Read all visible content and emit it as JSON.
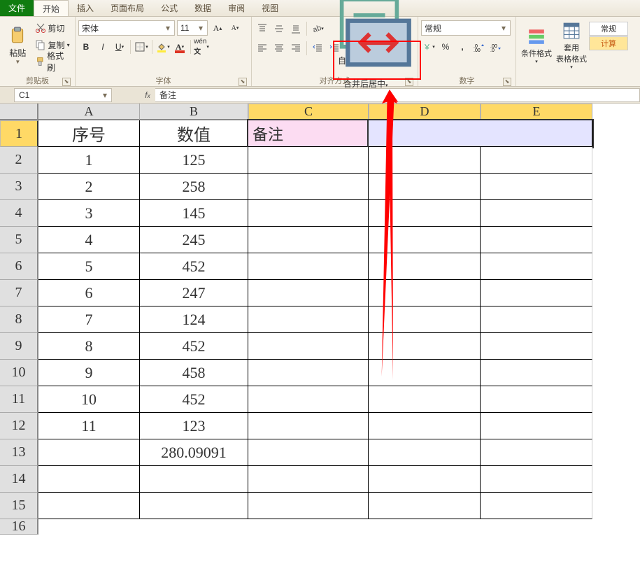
{
  "menu": {
    "file": "文件",
    "home": "开始",
    "insert": "插入",
    "pagelayout": "页面布局",
    "formulas": "公式",
    "data": "数据",
    "review": "审阅",
    "view": "视图"
  },
  "clipboard": {
    "paste": "粘贴",
    "cut": "剪切",
    "copy": "复制",
    "fmtpainter": "格式刷",
    "group": "剪贴板"
  },
  "font": {
    "name": "宋体",
    "size": "11",
    "group": "字体"
  },
  "align": {
    "wrap": "自动换行",
    "merge": "合并后居中",
    "group": "对齐方式"
  },
  "number": {
    "format": "常规",
    "group": "数字"
  },
  "styles": {
    "cond": "条件格式",
    "table": "套用\n表格格式",
    "normal": "常规",
    "calc": "计算"
  },
  "namebox": "C1",
  "formula": "备注",
  "cols": [
    "A",
    "B",
    "C",
    "D",
    "E"
  ],
  "rows": [
    "1",
    "2",
    "3",
    "4",
    "5",
    "6",
    "7",
    "8",
    "9",
    "10",
    "11",
    "12",
    "13",
    "14",
    "15",
    "16"
  ],
  "headers": {
    "a": "序号",
    "b": "数值",
    "c": "备注"
  },
  "data": [
    {
      "a": "1",
      "b": "125"
    },
    {
      "a": "2",
      "b": "258"
    },
    {
      "a": "3",
      "b": "145"
    },
    {
      "a": "4",
      "b": "245"
    },
    {
      "a": "5",
      "b": "452"
    },
    {
      "a": "6",
      "b": "247"
    },
    {
      "a": "7",
      "b": "124"
    },
    {
      "a": "8",
      "b": "452"
    },
    {
      "a": "9",
      "b": "458"
    },
    {
      "a": "10",
      "b": "452"
    },
    {
      "a": "11",
      "b": "123"
    }
  ],
  "totalB": "280.09091"
}
